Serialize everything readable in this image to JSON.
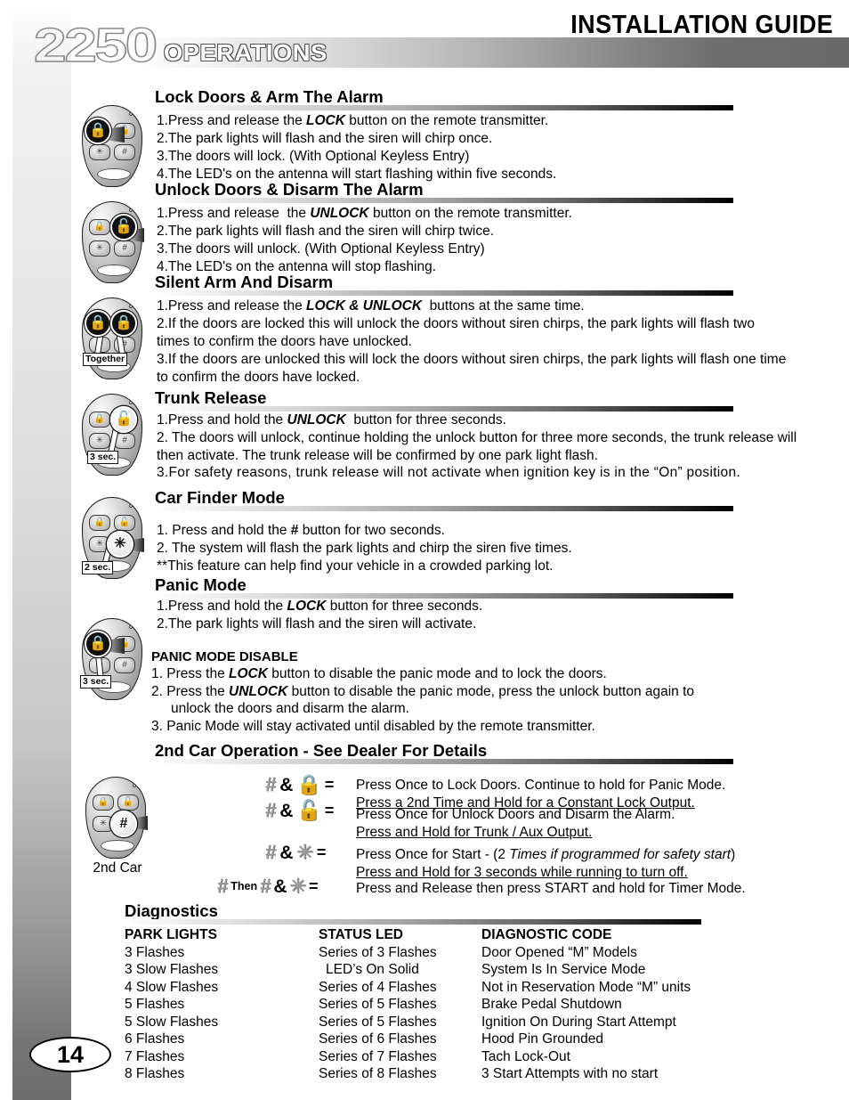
{
  "header": {
    "guide_title": "INSTALLATION GUIDE",
    "model_number": "2250",
    "model_word": "OPERATIONS"
  },
  "page_number": "14",
  "sections": [
    {
      "id": "lock-arm",
      "title": "Lock Doors & Arm The Alarm",
      "lines": [
        "1.Press and release the LOCK button on the remote transmitter.",
        "2.The park lights will flash and the siren will chirp once.",
        "3.The doors will lock. (With Optional Keyless Entry)",
        "4.The LED's on the antenna will start flashing within five seconds."
      ]
    },
    {
      "id": "unlock-disarm",
      "title": "Unlock Doors & Disarm The Alarm",
      "lines": [
        "1.Press and release  the UNLOCK button on the remote transmitter.",
        "2.The park lights  will flash and the siren will chirp twice.",
        "3.The doors will unlock. (With Optional Keyless Entry)",
        "4.The LED's on the antenna  will stop flashing."
      ]
    },
    {
      "id": "silent-arm",
      "title": "Silent Arm And Disarm",
      "lines": [
        "1.Press and release the LOCK & UNLOCK  buttons at the same time.",
        "2.If the doors are  locked  this will unlock the doors without siren chirps, the park lights will flash two  times to confirm the doors have unlocked.",
        "3.If the doors are unlocked this will lock the doors without siren chirps, the park lights will flash one time to confirm the doors have locked."
      ]
    },
    {
      "id": "trunk-release",
      "title": "Trunk Release",
      "lines": [
        "1.Press and hold the UNLOCK  button for three seconds.",
        "2.   The doors will unlock, continue holding the unlock button  for three more seconds, the trunk release will  then activate. The trunk release will be confirmed by one park light flash.",
        "3.For safety reasons,  trunk release will not activate when ignition key is in the “On” position."
      ]
    },
    {
      "id": "car-finder",
      "title": "Car Finder Mode",
      "lines": [
        "1. Press and hold the # button for two seconds.",
        "2. The system will flash the park lights and chirp the siren five times.",
        "**This feature can help find your vehicle in a crowded parking lot."
      ]
    },
    {
      "id": "panic-mode",
      "title": "Panic Mode",
      "lines": [
        "1.Press and hold the LOCK button for three seconds.",
        "2.The park lights will flash and the siren will activate."
      ],
      "sub_title": "PANIC MODE DISABLE",
      "sub_lines": [
        "1. Press the LOCK button to disable the panic mode and to lock the doors.",
        "2. Press the UNLOCK button to disable the panic mode, press the unlock button again to unlock the doors and disarm the alarm.",
        "3. Panic Mode will stay activated until disabled by the remote transmitter."
      ]
    },
    {
      "id": "second-car",
      "title": "2nd Car Operation - See Dealer For Details"
    },
    {
      "id": "diagnostics",
      "title": "Diagnostics"
    }
  ],
  "fobs": {
    "lock": {
      "caption": "",
      "highlight": "lock-closed"
    },
    "unlock": {
      "caption": "",
      "highlight": "lock-open"
    },
    "silent": {
      "caption": "",
      "tag": "Together"
    },
    "trunk": {
      "caption": "",
      "tag": "3 sec."
    },
    "carfinder": {
      "caption": "",
      "tag": "2 sec."
    },
    "panic": {
      "caption": "",
      "tag": "3 sec."
    },
    "secondcar": {
      "caption": "2nd Car"
    },
    "button_glyphs": {
      "lock_closed": " ",
      "lock_open": " ",
      "star": "✳",
      "hash": "#"
    }
  },
  "second_car": {
    "rows": [
      {
        "glyphs": [
          "hash",
          "amp",
          "lock-closed"
        ],
        "line1": "Press Once to Lock Doors. Continue to hold for Panic Mode.",
        "line2": "Press a 2nd Time and Hold for a Constant Lock Output."
      },
      {
        "glyphs": [
          "hash",
          "amp",
          "lock-open"
        ],
        "line1": "Press Once for Unlock Doors and Disarm the Alarm.",
        "line2": "Press and Hold for Trunk / Aux Output."
      },
      {
        "glyphs": [
          "hash",
          "amp",
          "star"
        ],
        "line1_a": "Press Once for Start - (2 ",
        "line1_it": "Times if programmed for safety start",
        "line1_b": ")",
        "line2": "Press and Hold for 3 seconds while running to turn off."
      },
      {
        "glyphs": [
          "hash",
          "then",
          "hash",
          "amp",
          "star"
        ],
        "then_label": "Then",
        "line1": "Press and Release then press START and hold for Timer Mode."
      }
    ],
    "equals": "="
  },
  "diagnostics": {
    "columns": [
      "PARK LIGHTS",
      "STATUS LED",
      "DIAGNOSTIC CODE"
    ],
    "rows": [
      [
        "3 Flashes",
        "Series of 3 Flashes",
        "Door Opened “M” Models"
      ],
      [
        "3 Slow Flashes",
        "LED’s On Solid",
        "System Is In Service Mode"
      ],
      [
        "4 Slow Flashes",
        "Series of 4 Flashes",
        "Not in Reservation Mode “M” units"
      ],
      [
        "5 Flashes",
        "Series of 5 Flashes",
        "Brake Pedal Shutdown"
      ],
      [
        "5 Slow Flashes",
        "Series of 5 Flashes",
        " Ignition On During Start Attempt"
      ],
      [
        "6 Flashes",
        "Series of 6 Flashes",
        "Hood Pin Grounded"
      ],
      [
        "7 Flashes",
        "Series of 7 Flashes",
        "Tach Lock-Out"
      ],
      [
        "8 Flashes",
        "Series of 8 Flashes",
        "3 Start Attempts with no start"
      ]
    ]
  }
}
